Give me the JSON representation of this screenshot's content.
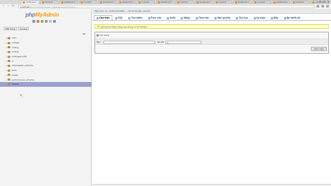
{
  "browser": {
    "tabs": [
      "phpMyAdmin",
      "localhost",
      "phpMyAdmin",
      "localhost",
      "phpMyAdmin",
      "phpMyAdmin",
      "localhost",
      "phpMyAdmin",
      "localhost",
      "phpMyAdmin",
      "localhost",
      "phpMyAdmin",
      "localhost",
      "phpMyAdmin",
      "localhost",
      "phpMyAdmin"
    ],
    "url_domain": "localhost",
    "url_path": "/phpmyadmin/server_databases.php?token=..."
  },
  "sidebar": {
    "logo_a": "php",
    "logo_b": "MyAdmin",
    "buttons": [
      "Mới dùng",
      "Cơ ảng"
    ],
    "collapse": "◄◄",
    "databases": [
      {
        "name": "adm",
        "expander": "+"
      },
      {
        "name": "1234pt",
        "expander": "+"
      },
      {
        "name": "coding",
        "expander": "+"
      },
      {
        "name": "coding",
        "expander": "+"
      },
      {
        "name": "codingsecurity",
        "expander": "+"
      },
      {
        "name": "ct",
        "expander": "+"
      },
      {
        "name": "information_schema",
        "expander": "+"
      },
      {
        "name": "joins",
        "expander": "+"
      },
      {
        "name": "mysql",
        "expander": "+"
      },
      {
        "name": "performance_schema",
        "expander": "+"
      },
      {
        "name": "laravel",
        "expander": "+",
        "selected": true
      }
    ]
  },
  "main": {
    "breadcrumb": [
      "Máy phục vụ: localhost:3306",
      "Cơ sở dữ liệu: laravel"
    ],
    "tabs": [
      "Cấu trúc",
      "SQL",
      "Tìm kiếm",
      "Truy vấn",
      "Xuất",
      "Nhập",
      "Thao tác",
      "Đặc quyền",
      "Thủ tục",
      "Sự kiện",
      "Bẫy",
      "Bộ thiết kế"
    ],
    "active_tab": 0,
    "notice": "Không tìm thấy bảng nào trong cơ sở dữ liệu.",
    "create_table": {
      "legend": "Tạo bảng",
      "name_label": "Tên:",
      "name_value": "",
      "cols_label": "Số cột:",
      "cols_value": "4",
      "go_button": "Thực hiện"
    }
  }
}
